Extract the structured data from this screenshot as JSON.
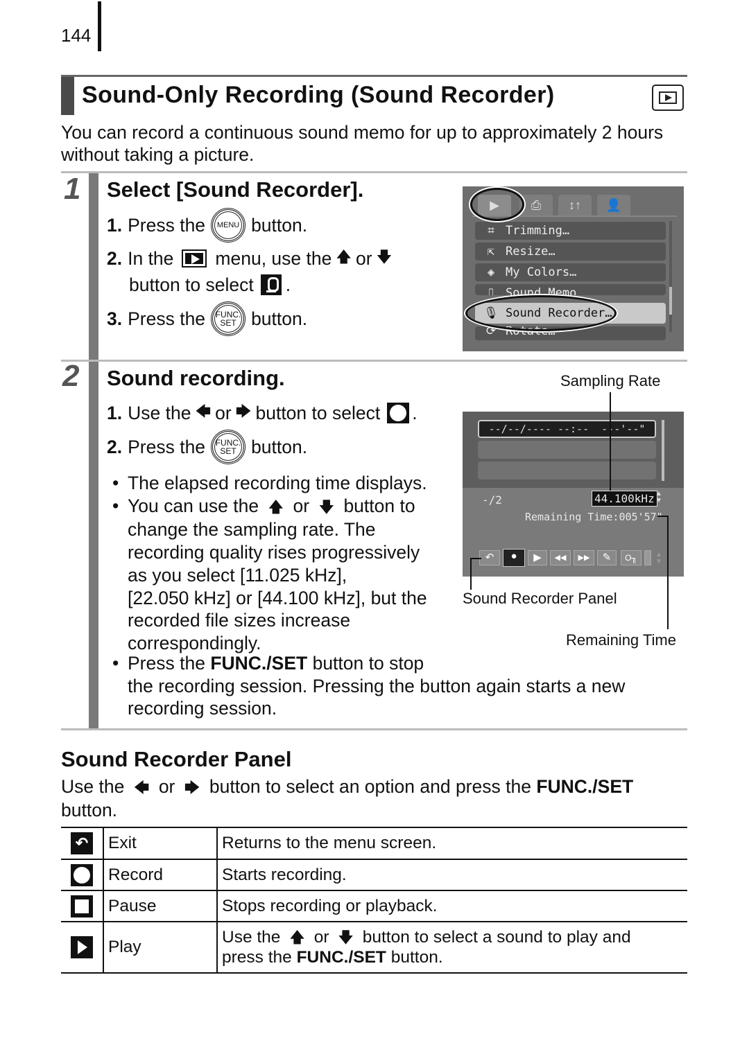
{
  "page": {
    "number": "144"
  },
  "header": {
    "title": "Sound-Only Recording (Sound Recorder)",
    "mode_icon": "playback-mode-icon",
    "intro": "You can record a continuous sound memo for up to approximately 2 hours without taking a picture."
  },
  "step1": {
    "number": "1",
    "heading": "Select [Sound Recorder].",
    "items": [
      {
        "num": "1.",
        "pre": "Press the",
        "button": "MENU",
        "post": "button."
      },
      {
        "num": "2.",
        "pre": "In the",
        "mid": "menu, use the",
        "or": "or",
        "line2": "button to select",
        "line2_end": "."
      },
      {
        "num": "3.",
        "pre": "Press the",
        "button_top": "FUNC.",
        "button_bottom": "SET",
        "post": "button."
      }
    ],
    "screen": {
      "tabs": [
        "▶",
        "⎙",
        "↕↑",
        "👤"
      ],
      "menu_items": [
        {
          "icon": "⌗",
          "label": "Trimming…"
        },
        {
          "icon": "⇱",
          "label": "Resize…"
        },
        {
          "icon": "◈",
          "label": "My Colors…"
        },
        {
          "icon": "⎍",
          "label": "Sound Memo"
        },
        {
          "icon": "🎙",
          "label": "Sound Recorder…"
        },
        {
          "icon": "⟳",
          "label": "Rotate…"
        }
      ],
      "selected_index": 4
    }
  },
  "step2": {
    "number": "2",
    "heading": "Sound recording.",
    "items": [
      {
        "num": "1.",
        "pre": "Use the",
        "or": "or",
        "post": "button to select",
        "end": "."
      },
      {
        "num": "2.",
        "pre": "Press the",
        "button_top": "FUNC.",
        "button_bottom": "SET",
        "post": "button."
      }
    ],
    "bullets": {
      "b1": "The elapsed recording time displays.",
      "b2_pre": "You can use the",
      "b2_or": "or",
      "b2_post": "button to",
      "b2_lines": [
        "change the sampling rate. The",
        "recording quality rises progressively",
        "as you select [11.025 kHz],",
        "[22.050 kHz] or [44.100 kHz], but the",
        "recorded file sizes increase",
        "correspondingly."
      ],
      "b3_pre": "Press the",
      "b3_bold": "FUNC./SET",
      "b3_post": "button to stop",
      "b3_lines": [
        "the recording session. Pressing the button again starts a new",
        "recording session."
      ]
    },
    "screen": {
      "list_row": "--/--/---- --:--  ---'--\"",
      "count": "-/2",
      "sampling_rate": "44.100kHz",
      "remaining": "Remaining Time:005'57\"",
      "controls": [
        "↶",
        "●",
        "▶",
        "◀◀",
        "▶▶",
        "✎",
        "O╖",
        "▮"
      ],
      "selected_control": 1
    },
    "callouts": {
      "sampling_rate": "Sampling Rate",
      "panel": "Sound Recorder Panel",
      "remaining": "Remaining Time"
    }
  },
  "panel_section": {
    "heading": "Sound Recorder Panel",
    "intro_pre": "Use the",
    "intro_or": "or",
    "intro_mid": "button to select an option and press the",
    "intro_bold": "FUNC./SET",
    "intro_post": "button.",
    "rows": [
      {
        "icon": "exit-icon",
        "name": "Exit",
        "desc": "Returns to the menu screen."
      },
      {
        "icon": "record-icon",
        "name": "Record",
        "desc": "Starts recording."
      },
      {
        "icon": "pause-icon",
        "name": "Pause",
        "desc": "Stops recording or playback."
      },
      {
        "icon": "play-icon",
        "name": "Play",
        "desc_pre": "Use the",
        "desc_or": "or",
        "desc_mid": "button to select a sound to play and",
        "desc_line2_pre": "press the",
        "desc_bold": "FUNC./SET",
        "desc_post": "button."
      }
    ]
  },
  "glyphs": {
    "up": "🡅",
    "down": "🡇",
    "left": "🡄",
    "right": "🡆",
    "bullet": "•"
  }
}
